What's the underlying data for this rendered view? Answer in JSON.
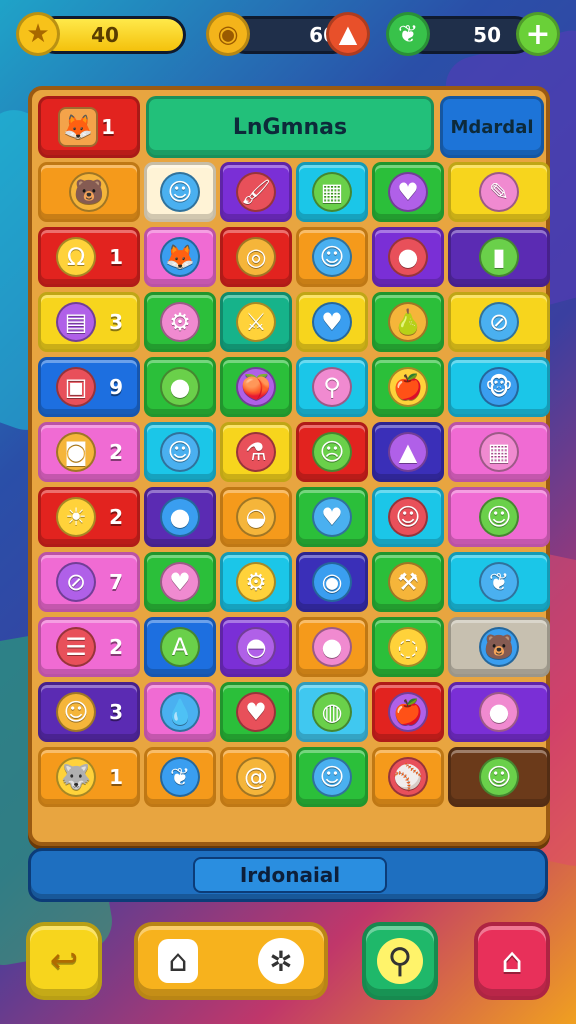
{
  "colors": {
    "yellow": "#f7d51d",
    "orange": "#f59a1b",
    "red": "#e2231f",
    "green": "#2bbf3a",
    "purple": "#7a2fd6",
    "pink": "#f06bd3",
    "cyan": "#1bc6e8",
    "blue": "#1d6fe0",
    "cream": "#fff3d6",
    "gray": "#c7c0b0",
    "brown": "#6b3a1a",
    "teal": "#16b38a",
    "darkpurple": "#5b2bb3",
    "lightblue": "#40c8f0",
    "indigo": "#3a2fb8"
  },
  "topbar": {
    "level": "40",
    "coins": "60",
    "gems": "50"
  },
  "board": {
    "header": {
      "player_count": "1",
      "title": "LnGmnas",
      "mode": "Mdardal"
    },
    "rows": [
      {
        "cells": [
          {
            "bg": "orange",
            "icon": "bear-face-icon",
            "glyph": "🐻",
            "num": ""
          },
          {
            "bg": "cream",
            "icon": "smiley-face-icon",
            "glyph": "☺",
            "num": ""
          },
          {
            "bg": "purple",
            "icon": "paint-brush-icon",
            "glyph": "🖌",
            "num": ""
          },
          {
            "bg": "cyan",
            "icon": "picture-frame-icon",
            "glyph": "▦",
            "num": ""
          },
          {
            "bg": "green",
            "icon": "heart-icon",
            "glyph": "♥",
            "num": ""
          },
          {
            "bg": "yellow",
            "icon": "crossed-pencil-icon",
            "glyph": "✎",
            "num": ""
          }
        ]
      },
      {
        "cells": [
          {
            "bg": "red",
            "icon": "blue-blob-icon",
            "glyph": "Ω",
            "num": "1"
          },
          {
            "bg": "pink",
            "icon": "fox-character-icon",
            "glyph": "🦊",
            "num": ""
          },
          {
            "bg": "red",
            "icon": "green-ring-icon",
            "glyph": "◎",
            "num": ""
          },
          {
            "bg": "orange",
            "icon": "lime-smiley-icon",
            "glyph": "☺",
            "num": ""
          },
          {
            "bg": "purple",
            "icon": "purple-orb-icon",
            "glyph": "●",
            "num": ""
          },
          {
            "bg": "darkpurple",
            "icon": "jar-icon",
            "glyph": "▮",
            "num": ""
          }
        ]
      },
      {
        "cells": [
          {
            "bg": "yellow",
            "icon": "tv-screen-icon",
            "glyph": "▤",
            "num": "3"
          },
          {
            "bg": "green",
            "icon": "robot-face-icon",
            "glyph": "⚙",
            "num": ""
          },
          {
            "bg": "teal",
            "icon": "crossed-swords-icon",
            "glyph": "⚔",
            "num": ""
          },
          {
            "bg": "yellow",
            "icon": "heart-icon",
            "glyph": "♥",
            "num": ""
          },
          {
            "bg": "green",
            "icon": "pear-icon",
            "glyph": "🍐",
            "num": ""
          },
          {
            "bg": "yellow",
            "icon": "no-sign-icon",
            "glyph": "⊘",
            "num": ""
          }
        ]
      },
      {
        "cells": [
          {
            "bg": "blue",
            "icon": "framed-picture-icon",
            "glyph": "▣",
            "num": "9"
          },
          {
            "bg": "green",
            "icon": "tomato-icon",
            "glyph": "●",
            "num": ""
          },
          {
            "bg": "green",
            "icon": "plum-icon",
            "glyph": "🍑",
            "num": ""
          },
          {
            "bg": "cyan",
            "icon": "magnifier-ring-icon",
            "glyph": "⚲",
            "num": ""
          },
          {
            "bg": "green",
            "icon": "apple-icon",
            "glyph": "🍎",
            "num": ""
          },
          {
            "bg": "cyan",
            "icon": "monkey-face-icon",
            "glyph": "🐵",
            "num": ""
          }
        ]
      },
      {
        "cells": [
          {
            "bg": "pink",
            "icon": "camera-icon",
            "glyph": "◙",
            "num": "2"
          },
          {
            "bg": "cyan",
            "icon": "yellow-smiley-icon",
            "glyph": "☺",
            "num": ""
          },
          {
            "bg": "yellow",
            "icon": "potion-bottle-icon",
            "glyph": "⚗",
            "num": ""
          },
          {
            "bg": "red",
            "icon": "grumpy-blob-icon",
            "glyph": "☹",
            "num": ""
          },
          {
            "bg": "indigo",
            "icon": "carrot-icon",
            "glyph": "▲",
            "num": ""
          },
          {
            "bg": "pink",
            "icon": "painting-frame-icon",
            "glyph": "▦",
            "num": ""
          }
        ]
      },
      {
        "cells": [
          {
            "bg": "red",
            "icon": "sun-face-icon",
            "glyph": "☀",
            "num": "2"
          },
          {
            "bg": "darkpurple",
            "icon": "purple-orb-icon",
            "glyph": "●",
            "num": ""
          },
          {
            "bg": "orange",
            "icon": "purple-pot-icon",
            "glyph": "◒",
            "num": ""
          },
          {
            "bg": "green",
            "icon": "heart-icon",
            "glyph": "♥",
            "num": ""
          },
          {
            "bg": "cyan",
            "icon": "green-smiley-icon",
            "glyph": "☺",
            "num": ""
          },
          {
            "bg": "pink",
            "icon": "blue-smiley-icon",
            "glyph": "☺",
            "num": ""
          }
        ]
      },
      {
        "cells": [
          {
            "bg": "pink",
            "icon": "no-brush-icon",
            "glyph": "⊘",
            "num": "7"
          },
          {
            "bg": "green",
            "icon": "heart-icon",
            "glyph": "♥",
            "num": ""
          },
          {
            "bg": "cyan",
            "icon": "robot-face-icon",
            "glyph": "⚙",
            "num": ""
          },
          {
            "bg": "indigo",
            "icon": "blue-ring-icon",
            "glyph": "◉",
            "num": ""
          },
          {
            "bg": "green",
            "icon": "hammer-icon",
            "glyph": "⚒",
            "num": ""
          },
          {
            "bg": "cyan",
            "icon": "leaf-icon",
            "glyph": "❦",
            "num": ""
          }
        ]
      },
      {
        "cells": [
          {
            "bg": "pink",
            "icon": "burger-icon",
            "glyph": "☰",
            "num": "2"
          },
          {
            "bg": "blue",
            "icon": "letter-a-icon",
            "glyph": "A",
            "num": ""
          },
          {
            "bg": "purple",
            "icon": "garlic-icon",
            "glyph": "◓",
            "num": ""
          },
          {
            "bg": "orange",
            "icon": "orange-fruit-icon",
            "glyph": "●",
            "num": ""
          },
          {
            "bg": "green",
            "icon": "bead-icon",
            "glyph": "◌",
            "num": ""
          },
          {
            "bg": "gray",
            "icon": "bear-face-icon",
            "glyph": "🐻",
            "num": ""
          }
        ]
      },
      {
        "cells": [
          {
            "bg": "darkpurple",
            "icon": "chick-face-icon",
            "glyph": "☺",
            "num": "3"
          },
          {
            "bg": "pink",
            "icon": "blue-drop-icon",
            "glyph": "💧",
            "num": ""
          },
          {
            "bg": "green",
            "icon": "heart-icon",
            "glyph": "♥",
            "num": ""
          },
          {
            "bg": "lightblue",
            "icon": "striped-ball-icon",
            "glyph": "◍",
            "num": ""
          },
          {
            "bg": "red",
            "icon": "apple-icon",
            "glyph": "🍎",
            "num": ""
          },
          {
            "bg": "purple",
            "icon": "purple-blob-icon",
            "glyph": "●",
            "num": ""
          }
        ]
      },
      {
        "cells": [
          {
            "bg": "orange",
            "icon": "wolf-face-icon",
            "glyph": "🐺",
            "num": "1"
          },
          {
            "bg": "orange",
            "icon": "leaf-icon",
            "glyph": "❦",
            "num": ""
          },
          {
            "bg": "orange",
            "icon": "swirl-candy-icon",
            "glyph": "@",
            "num": ""
          },
          {
            "bg": "green",
            "icon": "yellow-smiley-icon",
            "glyph": "☺",
            "num": ""
          },
          {
            "bg": "orange",
            "icon": "baseball-icon",
            "glyph": "⚾",
            "num": ""
          },
          {
            "bg": "brown",
            "icon": "sailor-face-icon",
            "glyph": "☺",
            "num": ""
          }
        ]
      }
    ]
  },
  "footer": {
    "label": "Irdonaial"
  },
  "nav": {
    "back_glyph": "↩",
    "home_glyph": "⌂",
    "compass_glyph": "✲",
    "search_glyph": "⚲",
    "home2_glyph": "⌂"
  }
}
